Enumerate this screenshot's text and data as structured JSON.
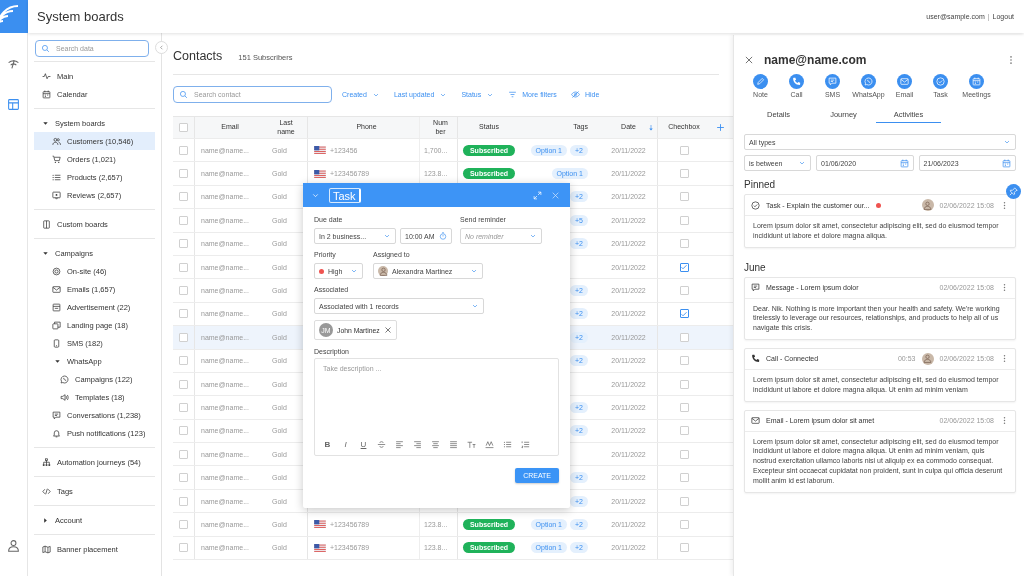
{
  "header": {
    "title": "System boards",
    "user": "user@sample.com",
    "separator": "|",
    "logout": "Logout"
  },
  "sidebar": {
    "search": {
      "placeholder": "Search data"
    },
    "sections": [
      {
        "items": [
          {
            "label": "Main",
            "selected": false
          },
          {
            "label": "Calendar",
            "selected": false
          }
        ]
      },
      {
        "items": [
          {
            "label": "System boards",
            "selected": false,
            "expanded": true,
            "children": [
              {
                "label": "Customers (10,546)",
                "selected": true
              },
              {
                "label": "Orders (1,021)",
                "selected": false
              },
              {
                "label": "Products (2,657)",
                "selected": false
              },
              {
                "label": "Reviews (2,657)",
                "selected": false
              }
            ]
          }
        ]
      },
      {
        "items": [
          {
            "label": "Custom boards",
            "selected": false
          }
        ]
      },
      {
        "items": [
          {
            "label": "Campaigns",
            "selected": false,
            "expanded": true,
            "children": [
              {
                "label": "On-site (46)",
                "selected": false
              },
              {
                "label": "Emails (1,657)",
                "selected": false
              },
              {
                "label": "Advertisement (22)",
                "selected": false
              },
              {
                "label": "Landing page (18)",
                "selected": false
              },
              {
                "label": "SMS (182)",
                "selected": false
              },
              {
                "label": "WhatsApp",
                "selected": false,
                "expanded": true,
                "children": [
                  {
                    "label": "Campaigns (122)",
                    "selected": false
                  },
                  {
                    "label": "Templates (18)",
                    "selected": false
                  }
                ]
              },
              {
                "label": "Conversations (1,238)",
                "selected": false
              },
              {
                "label": "Push notifications (123)",
                "selected": false
              }
            ]
          }
        ]
      },
      {
        "items": [
          {
            "label": "Automation journeys (54)",
            "selected": false
          }
        ]
      },
      {
        "items": [
          {
            "label": "Tags",
            "selected": false
          }
        ]
      },
      {
        "items": [
          {
            "label": "Account",
            "selected": false,
            "expanded": false
          }
        ]
      },
      {
        "items": [
          {
            "label": "Banner placement",
            "selected": false
          }
        ]
      }
    ]
  },
  "contacts": {
    "title": "Contacts",
    "count": "151 Subscribers",
    "search": {
      "placeholder": "Search contact"
    },
    "filters": [
      "Created",
      "Last updated",
      "Status"
    ],
    "more_filters": "More filters",
    "hide": "Hide",
    "table": {
      "select_all": false,
      "columns": [
        "Email",
        "Last name",
        "Phone",
        "Number",
        "Status",
        "Tags",
        "Date",
        "Chechbox"
      ],
      "rows": [
        {
          "email": "name@name...",
          "last_name": "Gold",
          "phone": "+123456",
          "number": "1,700...",
          "status": "Subscribed",
          "tags": [
            "Option 1",
            "+2"
          ],
          "date": "20/11/2022",
          "checked": false,
          "selected": false,
          "hovered": false
        },
        {
          "email": "name@name...",
          "last_name": "Gold",
          "phone": "+123456789",
          "number": "123.8...",
          "status": "Subscribed",
          "tags": [
            "Option 1"
          ],
          "date": "20/11/2022",
          "checked": false,
          "selected": false,
          "hovered": false
        },
        {
          "email": "name@name...",
          "last_name": "Gold",
          "tags": [
            "+2"
          ],
          "date": "20/11/2022",
          "checked": false,
          "selected": false,
          "hovered": false
        },
        {
          "email": "name@name...",
          "last_name": "Gold",
          "tags": [
            "+5"
          ],
          "date": "20/11/2022",
          "checked": false,
          "selected": false,
          "hovered": false
        },
        {
          "email": "name@name...",
          "last_name": "Gold",
          "tags": [
            "+2"
          ],
          "date": "20/11/2022",
          "checked": false,
          "selected": false,
          "hovered": false
        },
        {
          "email": "name@name...",
          "last_name": "Gold",
          "tags": [],
          "date": "20/11/2022",
          "checked": true,
          "selected": false,
          "hovered": false
        },
        {
          "email": "name@name...",
          "last_name": "Gold",
          "tags": [
            "+2"
          ],
          "date": "20/11/2022",
          "checked": false,
          "selected": false,
          "hovered": false
        },
        {
          "email": "name@name...",
          "last_name": "Gold",
          "tags": [
            "+2"
          ],
          "date": "20/11/2022",
          "checked": true,
          "selected": false,
          "hovered": false
        },
        {
          "email": "name@name...",
          "last_name": "Gold",
          "tags": [
            "+2"
          ],
          "date": "20/11/2022",
          "checked": false,
          "selected": false,
          "hovered": true
        },
        {
          "email": "name@name...",
          "last_name": "Gold",
          "tags": [
            "+2"
          ],
          "date": "20/11/2022",
          "checked": false,
          "selected": false,
          "hovered": false
        },
        {
          "email": "name@name...",
          "last_name": "Gold",
          "tags": [],
          "date": "20/11/2022",
          "checked": false,
          "selected": false,
          "hovered": false
        },
        {
          "email": "name@name...",
          "last_name": "Gold",
          "tags": [
            "+2"
          ],
          "date": "20/11/2022",
          "checked": false,
          "selected": false,
          "hovered": false
        },
        {
          "email": "name@name...",
          "last_name": "Gold",
          "tags": [
            "+2"
          ],
          "date": "20/11/2022",
          "checked": false,
          "selected": false,
          "hovered": false
        },
        {
          "email": "name@name...",
          "last_name": "Gold",
          "tags": [],
          "date": "20/11/2022",
          "checked": false,
          "selected": false,
          "hovered": false
        },
        {
          "email": "name@name...",
          "last_name": "Gold",
          "tags": [
            "+2"
          ],
          "date": "20/11/2022",
          "checked": false,
          "selected": false,
          "hovered": false
        },
        {
          "email": "name@name...",
          "last_name": "Gold",
          "tags": [
            "+2"
          ],
          "date": "20/11/2022",
          "checked": false,
          "selected": false,
          "hovered": false
        },
        {
          "email": "name@name...",
          "last_name": "Gold",
          "phone": "+123456789",
          "number": "123.8...",
          "status": "Subscribed",
          "tags": [
            "Option 1",
            "+2"
          ],
          "date": "20/11/2022",
          "checked": false,
          "selected": false,
          "hovered": false
        },
        {
          "email": "name@name...",
          "last_name": "Gold",
          "phone": "+123456789",
          "number": "123.8...",
          "status": "Subscribed",
          "tags": [
            "Option 1",
            "+2"
          ],
          "date": "20/11/2022",
          "checked": false,
          "selected": false,
          "hovered": false
        }
      ]
    }
  },
  "task_modal": {
    "title": "Task",
    "due_date": {
      "label": "Due date",
      "value": "In 2 business...",
      "time": "10:00 AM"
    },
    "reminder": {
      "label": "Send reminder",
      "placeholder": "No reminder"
    },
    "priority": {
      "label": "Priority",
      "value": "High"
    },
    "assigned": {
      "label": "Assigned to",
      "value": "Alexandra Martinez"
    },
    "associated": {
      "label": "Associated",
      "value": "Associated with 1 records",
      "chips": [
        {
          "initials": "JM",
          "label": "John Martinez"
        }
      ]
    },
    "description": {
      "label": "Description",
      "placeholder": "Take description ...",
      "toolbar": [
        "B",
        "I",
        "U"
      ]
    },
    "create": "CREATE"
  },
  "contact_panel": {
    "title": "name@name.com",
    "actions": [
      "Note",
      "Call",
      "SMS",
      "WhatsApp",
      "Email",
      "Task",
      "Meetings"
    ],
    "tabs": [
      {
        "label": "Details",
        "selected": false
      },
      {
        "label": "Journey",
        "selected": false
      },
      {
        "label": "Activities",
        "selected": true
      }
    ],
    "filters": {
      "type": "All types",
      "operator": "is between",
      "from": "01/06/2020",
      "to": "21/06/2023"
    },
    "sections": [
      {
        "heading": "Pinned",
        "pinned": true,
        "cards": [
          {
            "kind": "task",
            "title": "Task - Explain the customer our...",
            "unread": true,
            "avatar": true,
            "time": "02/06/2022 15:08",
            "body": "Lorem ipsum dolor sit amet, consectetur adipiscing elit, sed do eiusmod tempor incididunt ut labore et dolore magna aliqua."
          }
        ]
      },
      {
        "heading": "June",
        "pinned": false,
        "cards": [
          {
            "kind": "message",
            "title": "Message - Lorem ipsum dolor",
            "unread": false,
            "avatar": false,
            "time": "02/06/2022 15:08",
            "body": "Dear. Nik. Nothing is more important then your health and safety. We're working tirelessly to leverage our resources, relationships, and products to help all of us navigate this crisis."
          },
          {
            "kind": "call",
            "title": "Call - Connected",
            "duration": "00:53",
            "unread": false,
            "avatar": true,
            "time": "02/06/2022 15:08",
            "body": "Lorem ipsum dolor sit amet, consectetur adipiscing elit, sed do eiusmod tempor incididunt ut labore et dolore magna aliqua. Ut enim ad minim veniam"
          },
          {
            "kind": "email",
            "title": "Email - Lorem ipsum dolor sit amet",
            "unread": false,
            "avatar": false,
            "time": "02/06/2022 15:08",
            "body": "Lorem ipsum dolor sit amet, consectetur adipiscing elit, sed do eiusmod tempor incididunt ut labore et dolore magna aliqua. Ut enim ad minim veniam, quis nostrud exercitation ullamco laboris nisi ut aliquip ex ea commodo consequat. Excepteur sint occaecat cupidatat non proident, sunt in culpa qui officia deserunt mollit anim id est laborum."
          }
        ]
      }
    ]
  }
}
